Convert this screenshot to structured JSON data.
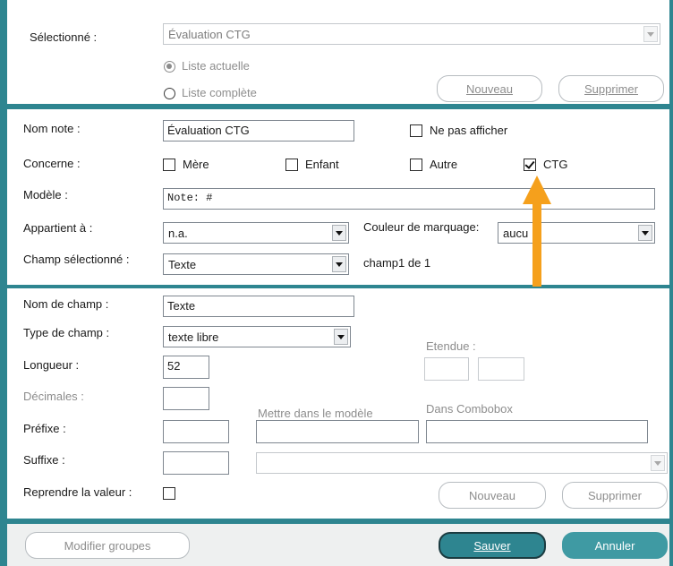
{
  "selection": {
    "label": "Sélectionné :",
    "selected_value": "Évaluation CTG",
    "radio_current": "Liste actuelle",
    "radio_full": "Liste complète",
    "new_button": "Nouveau",
    "delete_button": "Supprimer"
  },
  "note": {
    "name_label": "Nom note :",
    "name_value": "Évaluation CTG",
    "hide_label": "Ne pas afficher",
    "hide_checked": false,
    "concerne_label": "Concerne :",
    "concerne_options": [
      {
        "label": "Mère",
        "checked": false
      },
      {
        "label": "Enfant",
        "checked": false
      },
      {
        "label": "Autre",
        "checked": false
      },
      {
        "label": "CTG",
        "checked": true
      }
    ],
    "model_label": "Modèle :",
    "model_value": "Note: #",
    "belongs_label": "Appartient à :",
    "belongs_value": "n.a.",
    "marking_color_label": "Couleur de marquage:",
    "marking_color_value": "aucu",
    "selected_field_label": "Champ sélectionné :",
    "selected_field_value": "Texte",
    "field_count": "champ1 de 1"
  },
  "field": {
    "name_label": "Nom de champ :",
    "name_value": "Texte",
    "type_label": "Type de champ :",
    "type_value": "texte libre",
    "extent_label": "Etendue :",
    "length_label": "Longueur :",
    "length_value": "52",
    "decimals_label": "Décimales :",
    "put_in_model_label": "Mettre dans le modèle",
    "in_combobox_label": "Dans Combobox",
    "prefix_label": "Préfixe :",
    "suffix_label": "Suffixe :",
    "reuse_value_label": "Reprendre la valeur :",
    "reuse_value_checked": false,
    "new_button": "Nouveau",
    "delete_button": "Supprimer"
  },
  "footer": {
    "modify_groups_button": "Modifier groupes",
    "save_button": "Sauver",
    "cancel_button": "Annuler"
  },
  "annotation": {
    "icon": "arrow-up-icon",
    "color": "#f5a01c"
  },
  "colors": {
    "frame": "#2e8590",
    "primary_button": "#2e8590",
    "cancel_button": "#3f9aa3"
  }
}
